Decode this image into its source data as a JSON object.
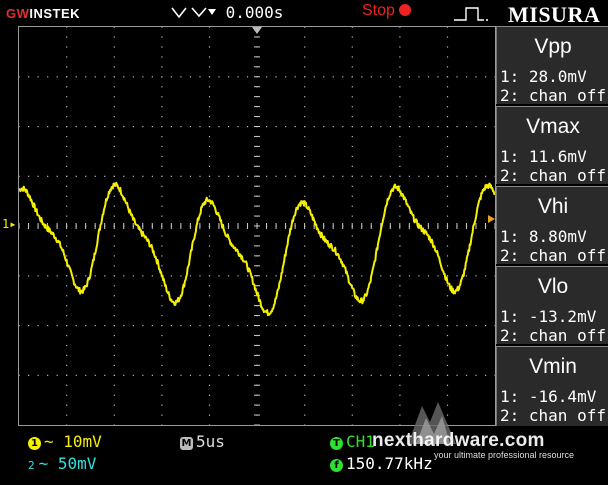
{
  "header": {
    "brand_gw": "GW",
    "brand_rest": "INSTEK",
    "trigger_offset": "0.000s",
    "run_state": "Stop",
    "mode_title": "MISURA"
  },
  "measurements": [
    {
      "name": "Vpp",
      "ch1": "1: 28.0mV",
      "ch2": "2: chan off"
    },
    {
      "name": "Vmax",
      "ch1": "1: 11.6mV",
      "ch2": "2: chan off"
    },
    {
      "name": "Vhi",
      "ch1": "1: 8.80mV",
      "ch2": "2: chan off"
    },
    {
      "name": "Vlo",
      "ch1": "1: -13.2mV",
      "ch2": "2: chan off"
    },
    {
      "name": "Vmin",
      "ch1": "1: -16.4mV",
      "ch2": "2: chan off"
    }
  ],
  "footer": {
    "ch1_scale": "~ 10mV",
    "ch2_scale": "~ 50mV",
    "ch2_num": "2",
    "timebase": "5us",
    "trigger_source": "CH1",
    "frequency": "150.77kHz"
  },
  "watermark": {
    "site": "nexthardware.com",
    "tagline": "your ultimate professional resource"
  },
  "trace": {
    "channel": "1",
    "color": "#f5f000",
    "grid_divisions": {
      "x": 10,
      "y": 8
    }
  },
  "colors": {
    "ch1": "#f5f000",
    "ch2": "#30e0e0",
    "trigger": "#30e030",
    "stop": "#e22222",
    "panel": "#2a2a2a"
  }
}
